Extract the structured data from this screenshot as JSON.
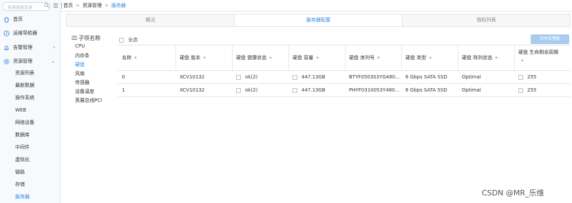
{
  "sidebar": {
    "search_placeholder": "快速搜索目录",
    "nav": [
      {
        "label": "首页",
        "icon": "home-icon"
      },
      {
        "label": "运维导航器",
        "icon": "compass-icon"
      },
      {
        "label": "告警管理",
        "icon": "bell-icon",
        "arrow": "›"
      },
      {
        "label": "资源管理",
        "icon": "gear-icon",
        "arrow": "⌄"
      }
    ],
    "sub_items": [
      "资源列表",
      "最新数据",
      "操作系统",
      "WEB",
      "网络设备",
      "数据库",
      "中间件",
      "虚拟化",
      "链路",
      "存储",
      "服务器"
    ],
    "active_sub_item": "服务器",
    "accent_color": "#2b8ae0"
  },
  "breadcrumb": {
    "items": [
      "首页",
      "资源管理",
      "服务器"
    ],
    "separator": ">"
  },
  "tabs": [
    {
      "label": "概况",
      "active": false
    },
    {
      "label": "服务器配置",
      "active": true
    },
    {
      "label": "指标列表",
      "active": false
    }
  ],
  "tree": {
    "title": "子项名称",
    "items": [
      "CPU",
      "内存条",
      "硬盘",
      "风扇",
      "传感器",
      "设备温度",
      "英展总线PCI"
    ],
    "active_item": "硬盘"
  },
  "toolbar": {
    "select_all_label": "全选",
    "merge_button_label": "合并告警配"
  },
  "table": {
    "columns": [
      "名称",
      "硬盘 版本",
      "硬盘 健康状态",
      "硬盘 容量",
      "硬盘 序列号",
      "硬盘 类型",
      "硬盘 阵列状态",
      "硬盘 生命剩余周期"
    ],
    "rows": [
      [
        "0",
        "XCV10132",
        "ok(2)",
        "447.13GB",
        "BTYF050303YG480...",
        "6 Gbps SATA SSD",
        "Optimal",
        "255"
      ],
      [
        "1",
        "XCV10132",
        "ok(2)",
        "447.13GB",
        "PHYF0310053Y480...",
        "6 Gbps SATA SSD",
        "Optimal",
        "255"
      ]
    ]
  },
  "watermark": "CSDN @MR_乐维"
}
